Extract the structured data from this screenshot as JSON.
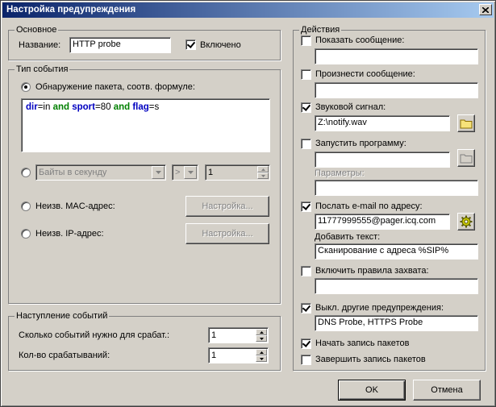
{
  "window": {
    "title": "Настройка предупреждения"
  },
  "basic": {
    "legend": "Основное",
    "name_label": "Название:",
    "name_value": "HTTP probe",
    "enabled_label": "Включено",
    "enabled_checked": true
  },
  "event_type": {
    "legend": "Тип события",
    "formula_label": "Обнаружение пакета, соотв. формуле:",
    "formula": {
      "t1": "dir",
      "t2": "=in ",
      "t3": "and",
      "t4": " ",
      "t5": "sport",
      "t6": "=80 ",
      "t7": "and",
      "t8": " ",
      "t9": "flag",
      "t10": "=s"
    },
    "bytes_combo": "Байты в секунду",
    "operator_combo": ">",
    "bytes_value": "1",
    "mac_label": "Неизв. MAC-адрес:",
    "mac_button": "Настройка...",
    "ip_label": "Неизв. IP-адрес:",
    "ip_button": "Настройка..."
  },
  "occurrence": {
    "legend": "Наступление событий",
    "count_label": "Сколько событий нужно для срабат.:",
    "count_value": "1",
    "triggers_label": "Кол-во срабатываний:",
    "triggers_value": "1"
  },
  "actions": {
    "legend": "Действия",
    "show_message_label": "Показать сообщение:",
    "show_message_value": "",
    "speak_message_label": "Произнести сообщение:",
    "speak_message_value": "",
    "sound_label": "Звуковой сигнал:",
    "sound_value": "Z:\\notify.wav",
    "run_program_label": "Запустить программу:",
    "run_program_value": "",
    "params_label": "Параметры:",
    "params_value": "",
    "email_label": "Послать e-mail по адресу:",
    "email_value": "11777999555@pager.icq.com",
    "add_text_label": "Добавить текст:",
    "add_text_value": "Сканирование с адреса %SIP%",
    "capture_label": "Включить правила захвата:",
    "capture_value": "",
    "disable_alerts_label": "Выкл. другие предупреждения:",
    "disable_alerts_value": "DNS Probe, HTTPS Probe",
    "start_capture_label": "Начать запись пакетов",
    "stop_capture_label": "Завершить запись пакетов"
  },
  "footer": {
    "ok": "OK",
    "cancel": "Отмена"
  }
}
